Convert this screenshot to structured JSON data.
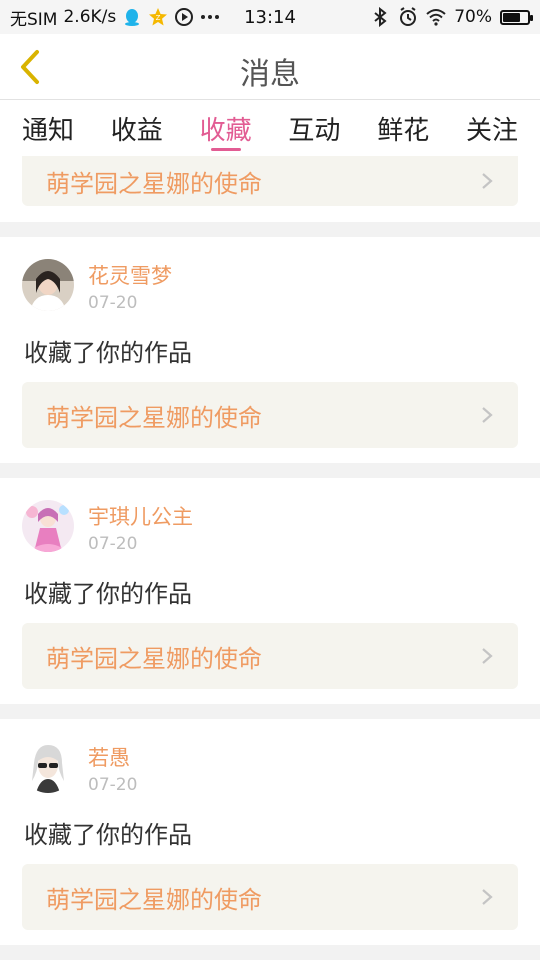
{
  "statusbar": {
    "carrier": "无SIM",
    "speed": "2.6K/s",
    "time": "13:14",
    "battery": "70%",
    "battery_level": 0.7
  },
  "header": {
    "title": "消息"
  },
  "tabs": [
    {
      "label": "通知",
      "active": false
    },
    {
      "label": "收益",
      "active": false
    },
    {
      "label": "收藏",
      "active": true
    },
    {
      "label": "互动",
      "active": false
    },
    {
      "label": "鲜花",
      "active": false
    },
    {
      "label": "关注",
      "active": false
    }
  ],
  "partial_item": {
    "work_title": "萌学园之星娜的使命"
  },
  "items": [
    {
      "username": "花灵雪梦",
      "date": "07-20",
      "action": "收藏了你的作品",
      "work_title": "萌学园之星娜的使命"
    },
    {
      "username": "宇琪儿公主",
      "date": "07-20",
      "action": "收藏了你的作品",
      "work_title": "萌学园之星娜的使命"
    },
    {
      "username": "若愚",
      "date": "07-20",
      "action": "收藏了你的作品",
      "work_title": "萌学园之星娜的使命"
    }
  ],
  "colors": {
    "accent": "#e25c93",
    "username": "#ef9b62",
    "back_arrow": "#d9b300"
  }
}
